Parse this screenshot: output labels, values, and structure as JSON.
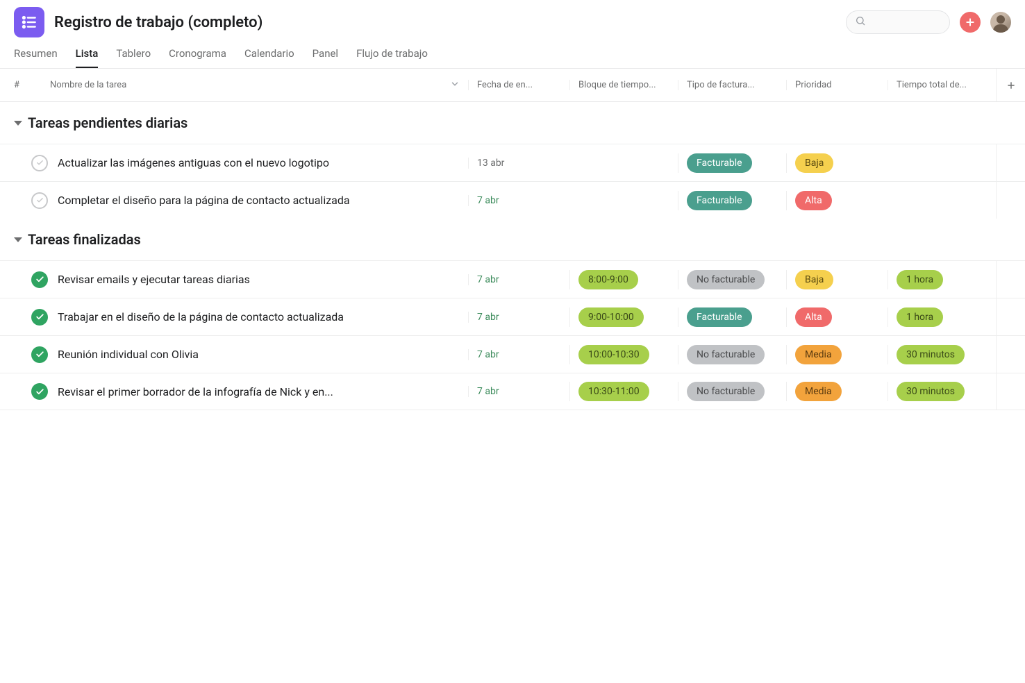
{
  "header": {
    "title": "Registro de trabajo (completo)",
    "search_placeholder": ""
  },
  "tabs": [
    {
      "label": "Resumen",
      "active": false
    },
    {
      "label": "Lista",
      "active": true
    },
    {
      "label": "Tablero",
      "active": false
    },
    {
      "label": "Cronograma",
      "active": false
    },
    {
      "label": "Calendario",
      "active": false
    },
    {
      "label": "Panel",
      "active": false
    },
    {
      "label": "Flujo de trabajo",
      "active": false
    }
  ],
  "columns": {
    "number": "#",
    "name": "Nombre de la tarea",
    "date": "Fecha de en...",
    "timeblock": "Bloque de tiempo...",
    "billing": "Tipo de factura...",
    "priority": "Prioridad",
    "totaltime": "Tiempo total de..."
  },
  "sections": [
    {
      "title": "Tareas pendientes diarias",
      "tasks": [
        {
          "done": false,
          "name": "Actualizar las imágenes antiguas con el nuevo logotipo",
          "date": "13 abr",
          "date_soon": false,
          "timeblock": "",
          "billing": {
            "text": "Facturable",
            "class": "pill-teal"
          },
          "priority": {
            "text": "Baja",
            "class": "pill-yellow"
          },
          "totaltime": ""
        },
        {
          "done": false,
          "name": "Completar el diseño para la página de contacto actualizada",
          "date": "7 abr",
          "date_soon": true,
          "timeblock": "",
          "billing": {
            "text": "Facturable",
            "class": "pill-teal"
          },
          "priority": {
            "text": "Alta",
            "class": "pill-red"
          },
          "totaltime": ""
        }
      ]
    },
    {
      "title": "Tareas finalizadas",
      "tasks": [
        {
          "done": true,
          "name": "Revisar emails y ejecutar tareas diarias",
          "date": "7 abr",
          "date_soon": true,
          "timeblock": {
            "text": "8:00-9:00",
            "class": "pill-green-olive"
          },
          "billing": {
            "text": "No facturable",
            "class": "pill-gray"
          },
          "priority": {
            "text": "Baja",
            "class": "pill-yellow"
          },
          "totaltime": {
            "text": "1 hora",
            "class": "pill-green-olive"
          }
        },
        {
          "done": true,
          "name": "Trabajar en el diseño de la página de contacto actualizada",
          "date": "7 abr",
          "date_soon": true,
          "timeblock": {
            "text": "9:00-10:00",
            "class": "pill-green-olive"
          },
          "billing": {
            "text": "Facturable",
            "class": "pill-teal"
          },
          "priority": {
            "text": "Alta",
            "class": "pill-red"
          },
          "totaltime": {
            "text": "1 hora",
            "class": "pill-green-olive"
          }
        },
        {
          "done": true,
          "name": "Reunión individual con Olivia",
          "date": "7 abr",
          "date_soon": true,
          "timeblock": {
            "text": "10:00-10:30",
            "class": "pill-green-olive"
          },
          "billing": {
            "text": "No facturable",
            "class": "pill-gray"
          },
          "priority": {
            "text": "Media",
            "class": "pill-orange"
          },
          "totaltime": {
            "text": "30 minutos",
            "class": "pill-green-olive"
          }
        },
        {
          "done": true,
          "name": "Revisar el primer borrador de la infografía de Nick y en...",
          "date": "7 abr",
          "date_soon": true,
          "timeblock": {
            "text": "10:30-11:00",
            "class": "pill-green-olive"
          },
          "billing": {
            "text": "No facturable",
            "class": "pill-gray"
          },
          "priority": {
            "text": "Media",
            "class": "pill-orange"
          },
          "totaltime": {
            "text": "30 minutos",
            "class": "pill-green-olive"
          }
        }
      ]
    }
  ]
}
